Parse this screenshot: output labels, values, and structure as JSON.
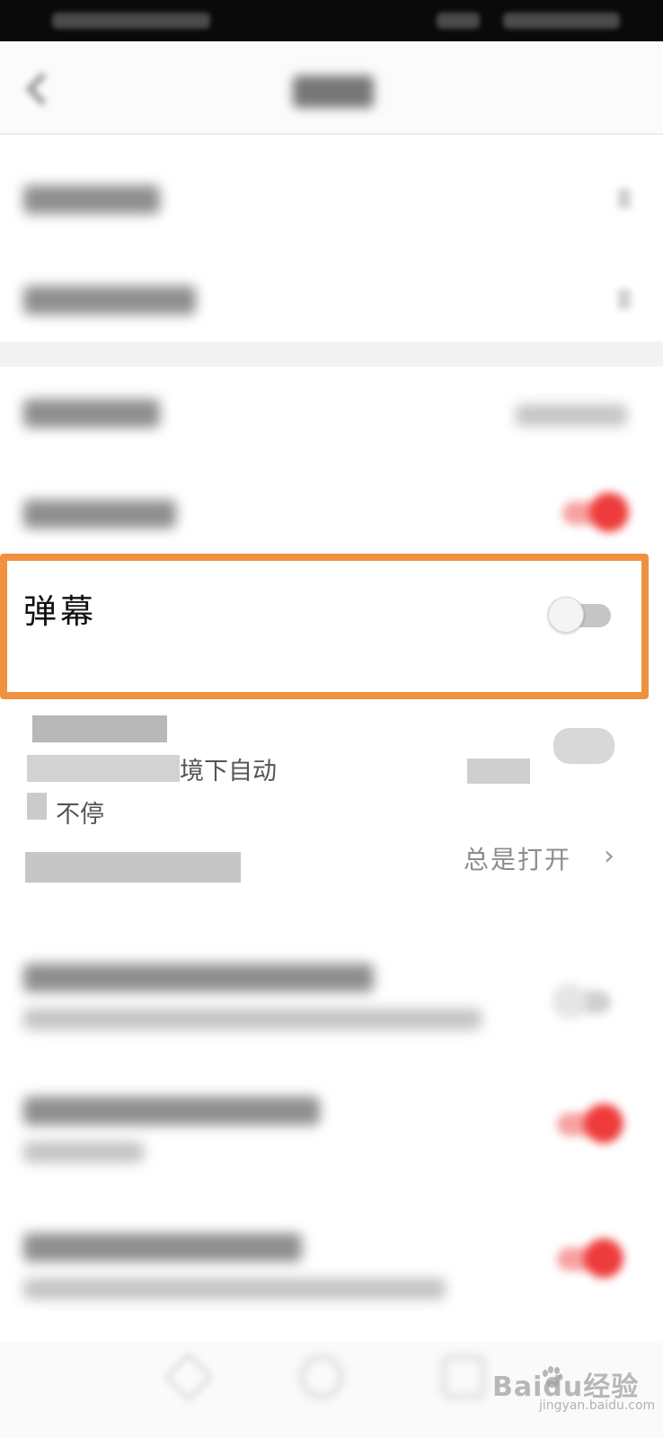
{
  "settings": {
    "danmu_label": "弹幕",
    "danmu_enabled": false,
    "description_fragment": "境下自动",
    "description_fragment_2": "不停",
    "always_open_value": "总是打开",
    "always_open_chevron": "›"
  },
  "watermark": {
    "brand": "Baidu经验",
    "url": "jingyan.baidu.com"
  },
  "colors": {
    "highlight": "#f0913f",
    "toggle_on": "#ee3b3b",
    "status_bar": "#0a0a0a"
  }
}
